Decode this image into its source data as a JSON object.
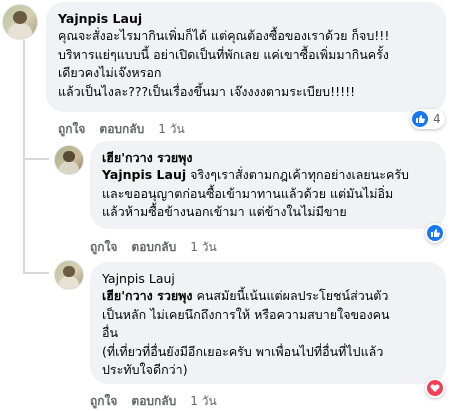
{
  "comments": [
    {
      "author": "Yajnpis Lauj",
      "lines": [
        "คุณจะสั่งอะไรมากินเพิ่มก็ได้ แต่คุณต้องซื้อของเราด้วย ก็จบ!!!",
        "บริหารแย่ๆแบบนี้ อย่าเปิดเป็นที่พักเลย แค่เขาซื้อเพิ่มมากินครั้ง",
        "เดียวคงไม่เจ๊งหรอก",
        "แล้วเป็นไงละ???เป็นเรื่องขึ้นมา เจ๊งงงงตามระเบียบ!!!!!"
      ],
      "actions": {
        "like": "ถูกใจ",
        "reply": "ตอบกลับ",
        "time": "1 วัน"
      },
      "reaction": {
        "icon": "like-icon",
        "count": "4"
      }
    },
    {
      "author": "เฮีย'กวาง รวยพุง",
      "tag": "Yajnpis Lauj",
      "first_line_rest": " จริงๆเราสั่งตามกฎเค้าทุกอย่างเลยนะครับ",
      "lines": [
        "และขออนุญาตก่อนซื้อเข้ามาทานแล้วด้วย แต่มันไม่อิ่ม",
        "แล้วห้ามซื้อข้างนอกเข้ามา แต่ข้างในไม่มีขาย"
      ],
      "actions": {
        "like": "ถูกใจ",
        "reply": "ตอบกลับ",
        "time": "1 วัน"
      },
      "reaction": {
        "icon": "like-icon"
      }
    },
    {
      "author": "Yajnpis Lauj",
      "tag": "เฮีย'กวาง รวยพุง",
      "first_line_rest": " คนสมัยนี้เน้นแต่ผลประโยชน์ส่วนตัว",
      "lines": [
        "เป็นหลัก ไม่เคยนึกถึงการให้ หรือความสบายใจของคน",
        "อื่น",
        "(ที่เที่ยวที่อื่นยังมีอีกเยอะครับ พาเพื่อนไปที่อื่นที่ไปแล้ว",
        "ประทับใจดีกว่า)"
      ],
      "actions": {
        "like": "ถูกใจ",
        "reply": "ตอบกลับ",
        "time": "1 วัน"
      },
      "reaction": {
        "icon": "heart-icon"
      }
    }
  ],
  "colors": {
    "bubble": "#f0f2f5",
    "like": "#1877f2",
    "love": "#f33e58",
    "meta": "#65676b"
  }
}
